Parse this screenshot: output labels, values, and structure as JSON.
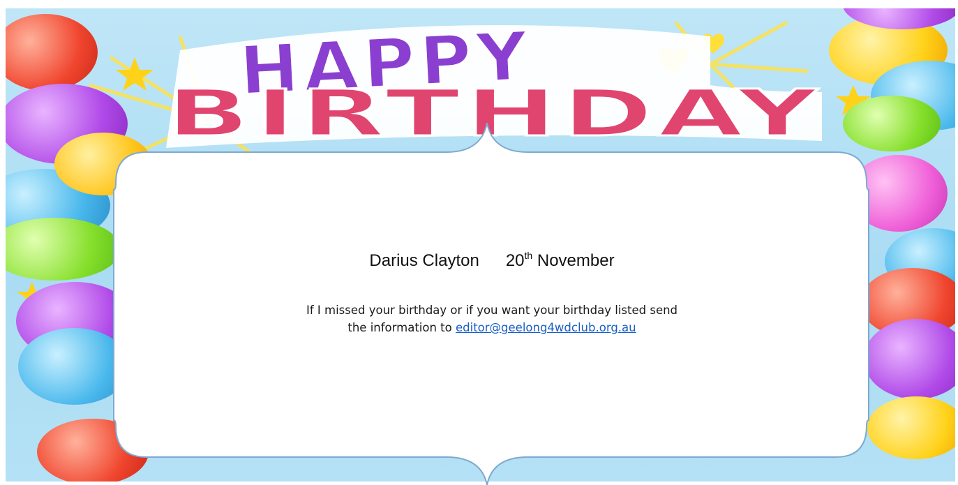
{
  "banner": {
    "word_top": "HAPPY",
    "word_bottom": "BIRTHDAY"
  },
  "birthday": {
    "name": "Darius Clayton",
    "day": "20",
    "day_suffix": "th",
    "month": "November"
  },
  "note": {
    "line1": "If I missed your birthday or if you want your birthday listed send",
    "line2_prefix": "the information to ",
    "email": "editor@geelong4wdclub.org.au"
  },
  "colors": {
    "sky": "#aadcf3",
    "happy_purple": "#8a3fd1",
    "birthday_pink": "#e0456f",
    "link_blue": "#1a5fc4",
    "panel_border": "#7ea9cf"
  },
  "icons": [
    "balloon-icon",
    "star-icon",
    "heart-icon",
    "sunburst-icon"
  ]
}
